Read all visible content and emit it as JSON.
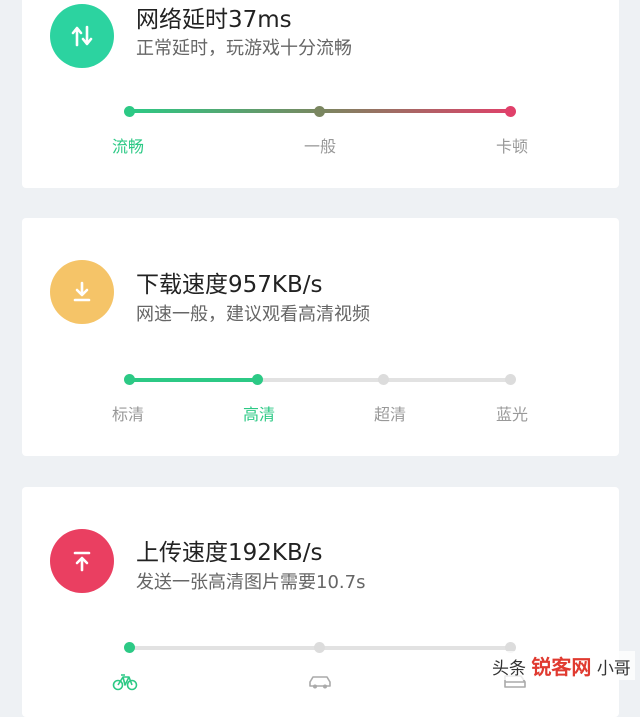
{
  "colors": {
    "green": "#2cc985",
    "olive": "#7a8660",
    "red": "#e0406a",
    "gray": "#dcdcdc",
    "yellow": "#f5c468",
    "pink": "#ea3f61"
  },
  "latency": {
    "icon": "up-down-arrows-icon",
    "title": "网络延时37ms",
    "subtitle": "正常延时，玩游戏十分流畅",
    "levels": [
      "流畅",
      "一般",
      "卡顿"
    ],
    "active_level": 0
  },
  "download": {
    "icon": "download-icon",
    "title": "下载速度957KB/s",
    "subtitle": "网速一般，建议观看高清视频",
    "levels": [
      "标清",
      "高清",
      "超清",
      "蓝光"
    ],
    "active_level": 1
  },
  "upload": {
    "icon": "upload-icon",
    "title": "上传速度192KB/s",
    "subtitle": "发送一张高清图片需要10.7s",
    "level_icons": [
      "bicycle-icon",
      "car-icon",
      "train-icon"
    ],
    "active_level": 0
  },
  "watermark": {
    "left": "头条",
    "brand": "锐客网",
    "right": "小哥"
  }
}
